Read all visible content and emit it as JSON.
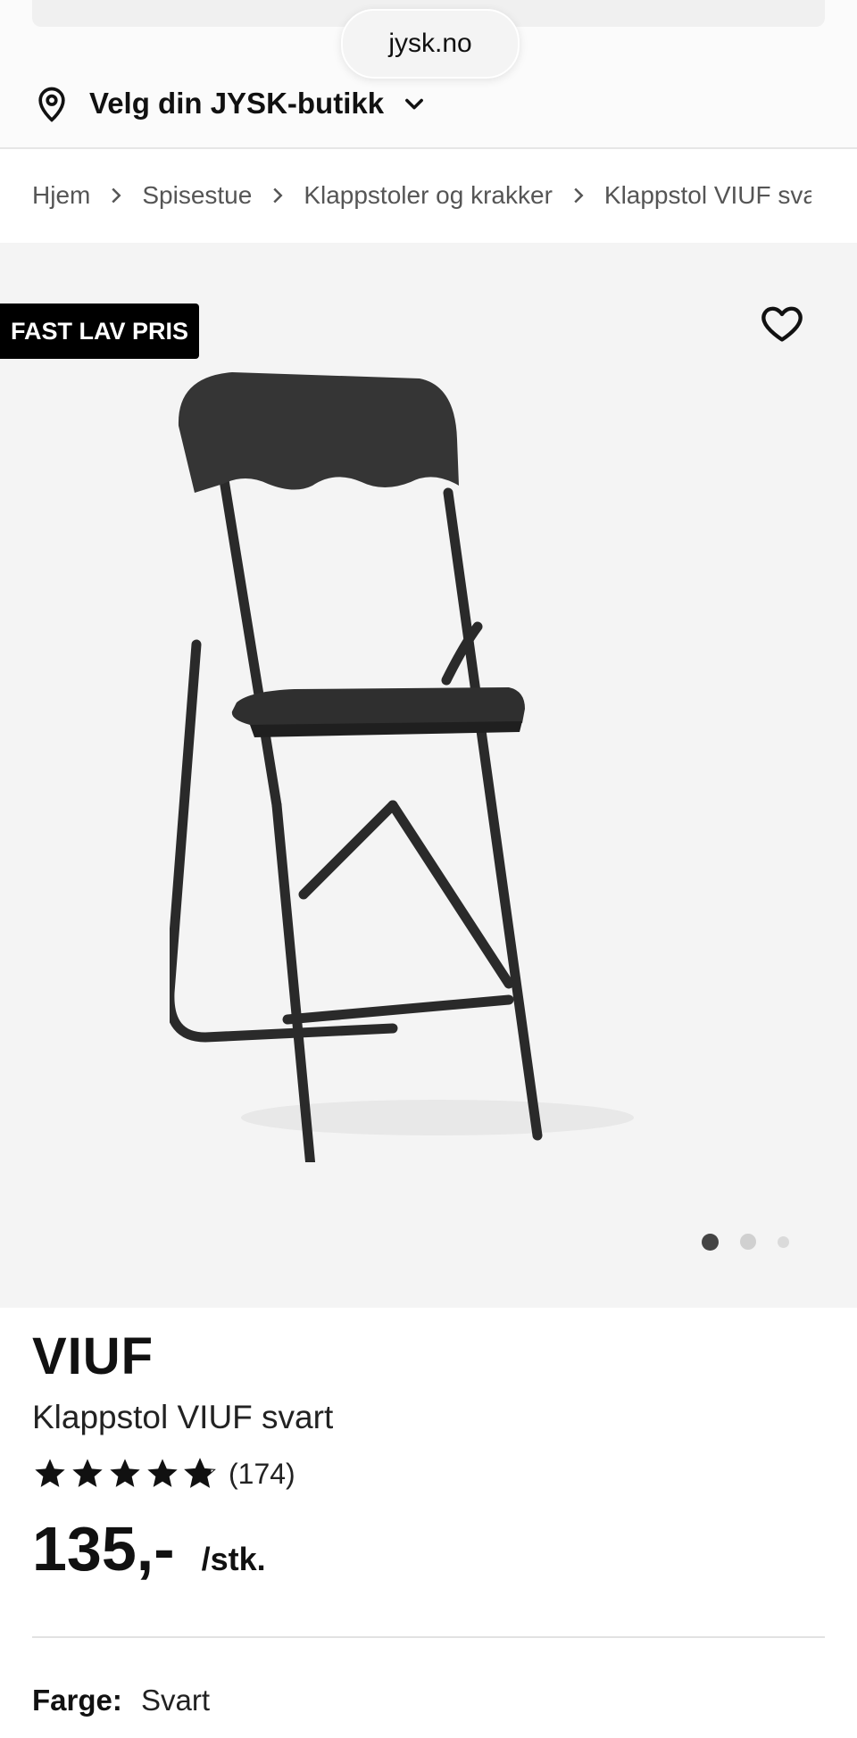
{
  "browser": {
    "url": "jysk.no"
  },
  "store_selector": {
    "label": "Velg din JYSK-butikk"
  },
  "breadcrumbs": [
    {
      "label": "Hjem"
    },
    {
      "label": "Spisestue"
    },
    {
      "label": "Klappstoler og krakker"
    },
    {
      "label": "Klappstol VIUF svart"
    }
  ],
  "product": {
    "badge": "FAST LAV PRIS",
    "brand": "VIUF",
    "name": "Klappstol VIUF svart",
    "rating": {
      "stars": 4.8,
      "max": 5,
      "count_text": "(174)"
    },
    "price": {
      "amount": "135,-",
      "unit": "/stk."
    },
    "color": {
      "label": "Farge:",
      "value": "Svart"
    }
  },
  "gallery": {
    "image_count": 3,
    "active_index": 0
  },
  "icons": {
    "location": "map-pin-icon",
    "chevron": "chevron-down-icon",
    "favorite": "heart-icon",
    "rating": "star-icon"
  },
  "colors": {
    "badge_bg": "#000000",
    "gallery_bg": "#f4f4f4",
    "text": "#111111",
    "active_dot": "#444444"
  }
}
